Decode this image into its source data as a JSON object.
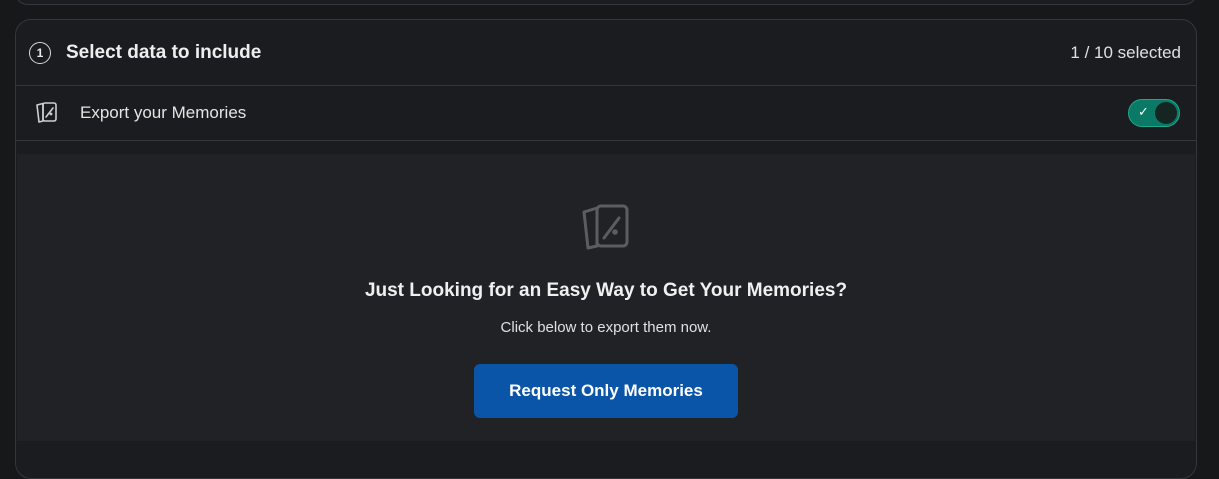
{
  "section": {
    "step_number": "1",
    "title": "Select data to include",
    "selected_count": "1 / 10 selected"
  },
  "memories_row": {
    "icon": "memories-icon",
    "label": "Export your Memories",
    "toggle_on": true,
    "toggle_check": "✓"
  },
  "panel": {
    "icon": "memories-icon",
    "title": "Just Looking for an Easy Way to Get Your Memories?",
    "subtitle": "Click below to export them now.",
    "button_label": "Request Only Memories"
  },
  "colors": {
    "accent_toggle": "#0a7a66",
    "button_blue": "#0b55a8",
    "background": "#17181a"
  }
}
